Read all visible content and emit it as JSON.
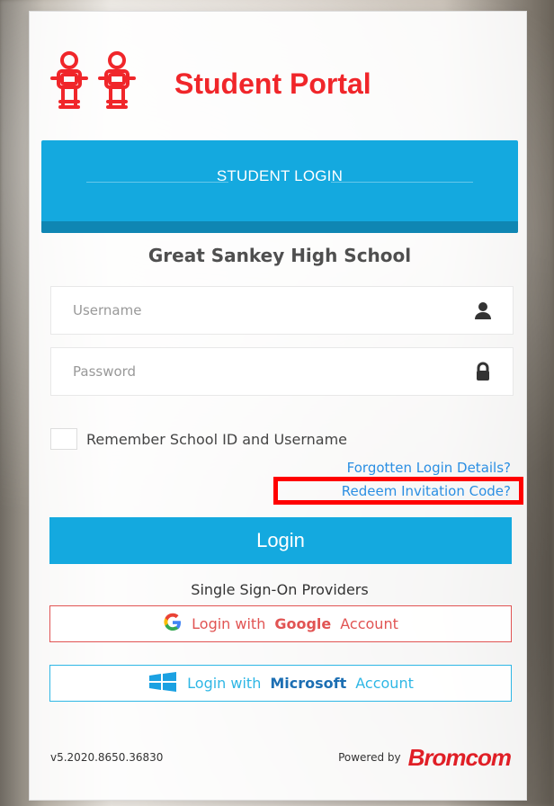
{
  "app": {
    "title": "Student Portal"
  },
  "tabs": {
    "active": "STUDENT LOGIN"
  },
  "school": {
    "name": "Great Sankey High School"
  },
  "form": {
    "username_placeholder": "Username",
    "password_placeholder": "Password",
    "remember_label": "Remember School ID and Username",
    "forgotten_link": "Forgotten Login Details?",
    "redeem_link": "Redeem Invitation Code?",
    "login_button": "Login"
  },
  "sso": {
    "title": "Single Sign-On Providers",
    "google": {
      "prefix": "Login with",
      "brand": "Google",
      "suffix": "Account"
    },
    "microsoft": {
      "prefix": "Login with",
      "brand": "Microsoft",
      "suffix": "Account"
    }
  },
  "footer": {
    "version": "v5.2020.8650.36830",
    "powered_by": "Powered by",
    "vendor": "Bromcom"
  },
  "icons": {
    "brand_logo": "student-robots-icon",
    "username": "user-icon",
    "password": "lock-icon",
    "google": "google-icon",
    "microsoft": "windows-icon"
  },
  "colors": {
    "brand_red": "#f0262a",
    "accent_blue": "#14a9df",
    "link_blue": "#2b8fe3",
    "highlight": "#ff0000"
  }
}
